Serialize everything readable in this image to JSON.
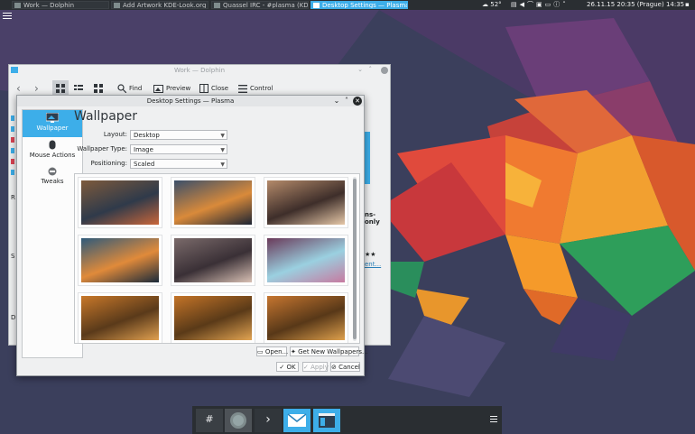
{
  "top_panel": {
    "tasks": [
      {
        "label": "Work — Dolphin",
        "active": false
      },
      {
        "label": "Add Artwork KDE-Look.org - C...",
        "active": false
      },
      {
        "label": "Quassel IRC - #plasma (KDE)...",
        "active": false
      },
      {
        "label": "Desktop Settings — Plasma",
        "active": true
      }
    ],
    "weather": "52°",
    "date": "26.11.15",
    "time": "20:35 (Prague)",
    "time2": "14:35"
  },
  "dolphin": {
    "title": "Work — Dolphin",
    "toolbar": {
      "find": "Find",
      "preview": "Preview",
      "close": "Close",
      "control": "Control"
    },
    "fragments": {
      "a": "ns-only",
      "b": "★★",
      "c": "ent..."
    },
    "side_letters": [
      "R",
      "S",
      "D"
    ]
  },
  "dialog": {
    "title": "Desktop Settings — Plasma",
    "categories": [
      {
        "label": "Wallpaper",
        "selected": true,
        "icon": "wallpaper-icon"
      },
      {
        "label": "Mouse Actions",
        "selected": false,
        "icon": "mouse-icon"
      },
      {
        "label": "Tweaks",
        "selected": false,
        "icon": "tweaks-icon"
      }
    ],
    "heading": "Wallpaper",
    "form": {
      "layout_label": "Layout:",
      "layout_value": "Desktop",
      "type_label": "Wallpaper Type:",
      "type_value": "Image",
      "positioning_label": "Positioning:",
      "positioning_value": "Scaled"
    },
    "wallpapers": [
      {
        "name": "city-light-trails-1",
        "colors": [
          "#7d5a3c",
          "#2f3a4a",
          "#c9663a"
        ]
      },
      {
        "name": "city-light-trails-2",
        "colors": [
          "#3b4f6a",
          "#d98a3a",
          "#1c2433"
        ]
      },
      {
        "name": "skyscrapers-up",
        "colors": [
          "#b48a6a",
          "#3e2e2a",
          "#e6c8a8"
        ]
      },
      {
        "name": "city-light-trails-3",
        "colors": [
          "#2f5a7a",
          "#e08a3a",
          "#1a2a3a"
        ]
      },
      {
        "name": "skyscrapers-dusk",
        "colors": [
          "#7a6a6a",
          "#3a3036",
          "#d8c0b4"
        ]
      },
      {
        "name": "purple-cups",
        "colors": [
          "#6a3a5a",
          "#9ad0e0",
          "#c77aa0"
        ]
      },
      {
        "name": "autumn-leaves-1",
        "colors": [
          "#c8782a",
          "#5a3a1a",
          "#e0a050"
        ]
      },
      {
        "name": "autumn-leaves-2",
        "colors": [
          "#c47428",
          "#5a3a18",
          "#e2a452"
        ]
      },
      {
        "name": "autumn-leaves-3",
        "colors": [
          "#c67630",
          "#583818",
          "#dea04c"
        ]
      }
    ],
    "buttons": {
      "open": "Open...",
      "get_new": "Get New Wallpapers...",
      "ok": "OK",
      "apply": "Apply",
      "cancel": "Cancel"
    }
  },
  "colors": {
    "accent": "#3daee9",
    "panel": "#2a2e32",
    "window": "#eff0f1"
  }
}
